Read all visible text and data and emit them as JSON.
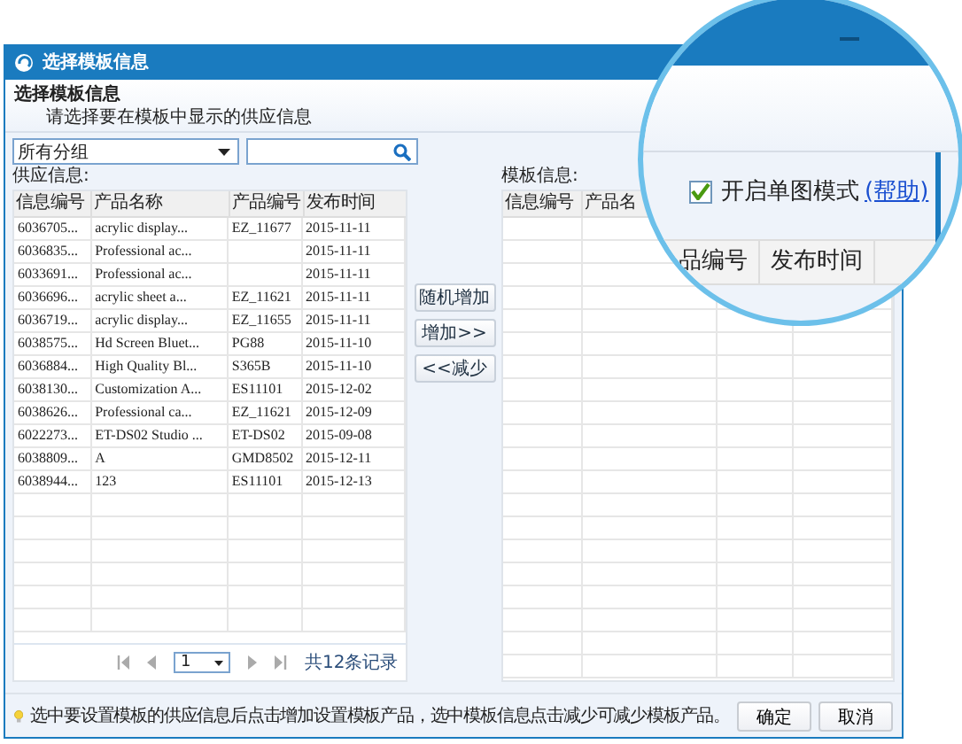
{
  "window": {
    "title": "选择模板信息"
  },
  "header": {
    "title": "选择模板信息",
    "subtitle": "请选择要在模板中显示的供应信息"
  },
  "group_select": {
    "value": "所有分组"
  },
  "supply": {
    "label": "供应信息:",
    "columns": [
      "信息编号",
      "产品名称",
      "产品编号",
      "发布时间"
    ],
    "rows": [
      [
        "6036705...",
        "acrylic display...",
        "EZ_11677",
        "2015-11-11"
      ],
      [
        "6036835...",
        "Professional ac...",
        "",
        "2015-11-11"
      ],
      [
        "6033691...",
        "Professional ac...",
        "",
        "2015-11-11"
      ],
      [
        "6036696...",
        "acrylic sheet a...",
        "EZ_11621",
        "2015-11-11"
      ],
      [
        "6036719...",
        "acrylic display...",
        "EZ_11655",
        "2015-11-11"
      ],
      [
        "6038575...",
        "Hd Screen Bluet...",
        "PG88",
        "2015-11-10"
      ],
      [
        "6036884...",
        "High Quality Bl...",
        "S365B",
        "2015-11-10"
      ],
      [
        "6038130...",
        "Customization A...",
        "ES11101",
        "2015-12-02"
      ],
      [
        "6038626...",
        "Professional ca...",
        "EZ_11621",
        "2015-12-09"
      ],
      [
        "6022273...",
        "ET-DS02 Studio ...",
        "ET-DS02",
        "2015-09-08"
      ],
      [
        "6038809...",
        "A",
        "GMD8502",
        "2015-12-11"
      ],
      [
        "6038944...",
        "123",
        "ES11101",
        "2015-12-13"
      ]
    ],
    "pager": {
      "page": "1",
      "total": "共12条记录"
    }
  },
  "move_buttons": [
    "随机增加",
    "增加>>",
    "<<减少"
  ],
  "template": {
    "label": "模板信息:",
    "columns": [
      "信息编号",
      "产品名"
    ]
  },
  "magnifier": {
    "checkbox": {
      "label": "开启单图模式",
      "checked": true
    },
    "help_link": "(帮助)",
    "columns": [
      "品编号",
      "发布时间"
    ]
  },
  "footer": {
    "hint": "选中要设置模板的供应信息后点击增加设置模板产品，选中模板信息点击减少可减少模板产品。",
    "buttons": [
      "确定",
      "取消"
    ]
  }
}
